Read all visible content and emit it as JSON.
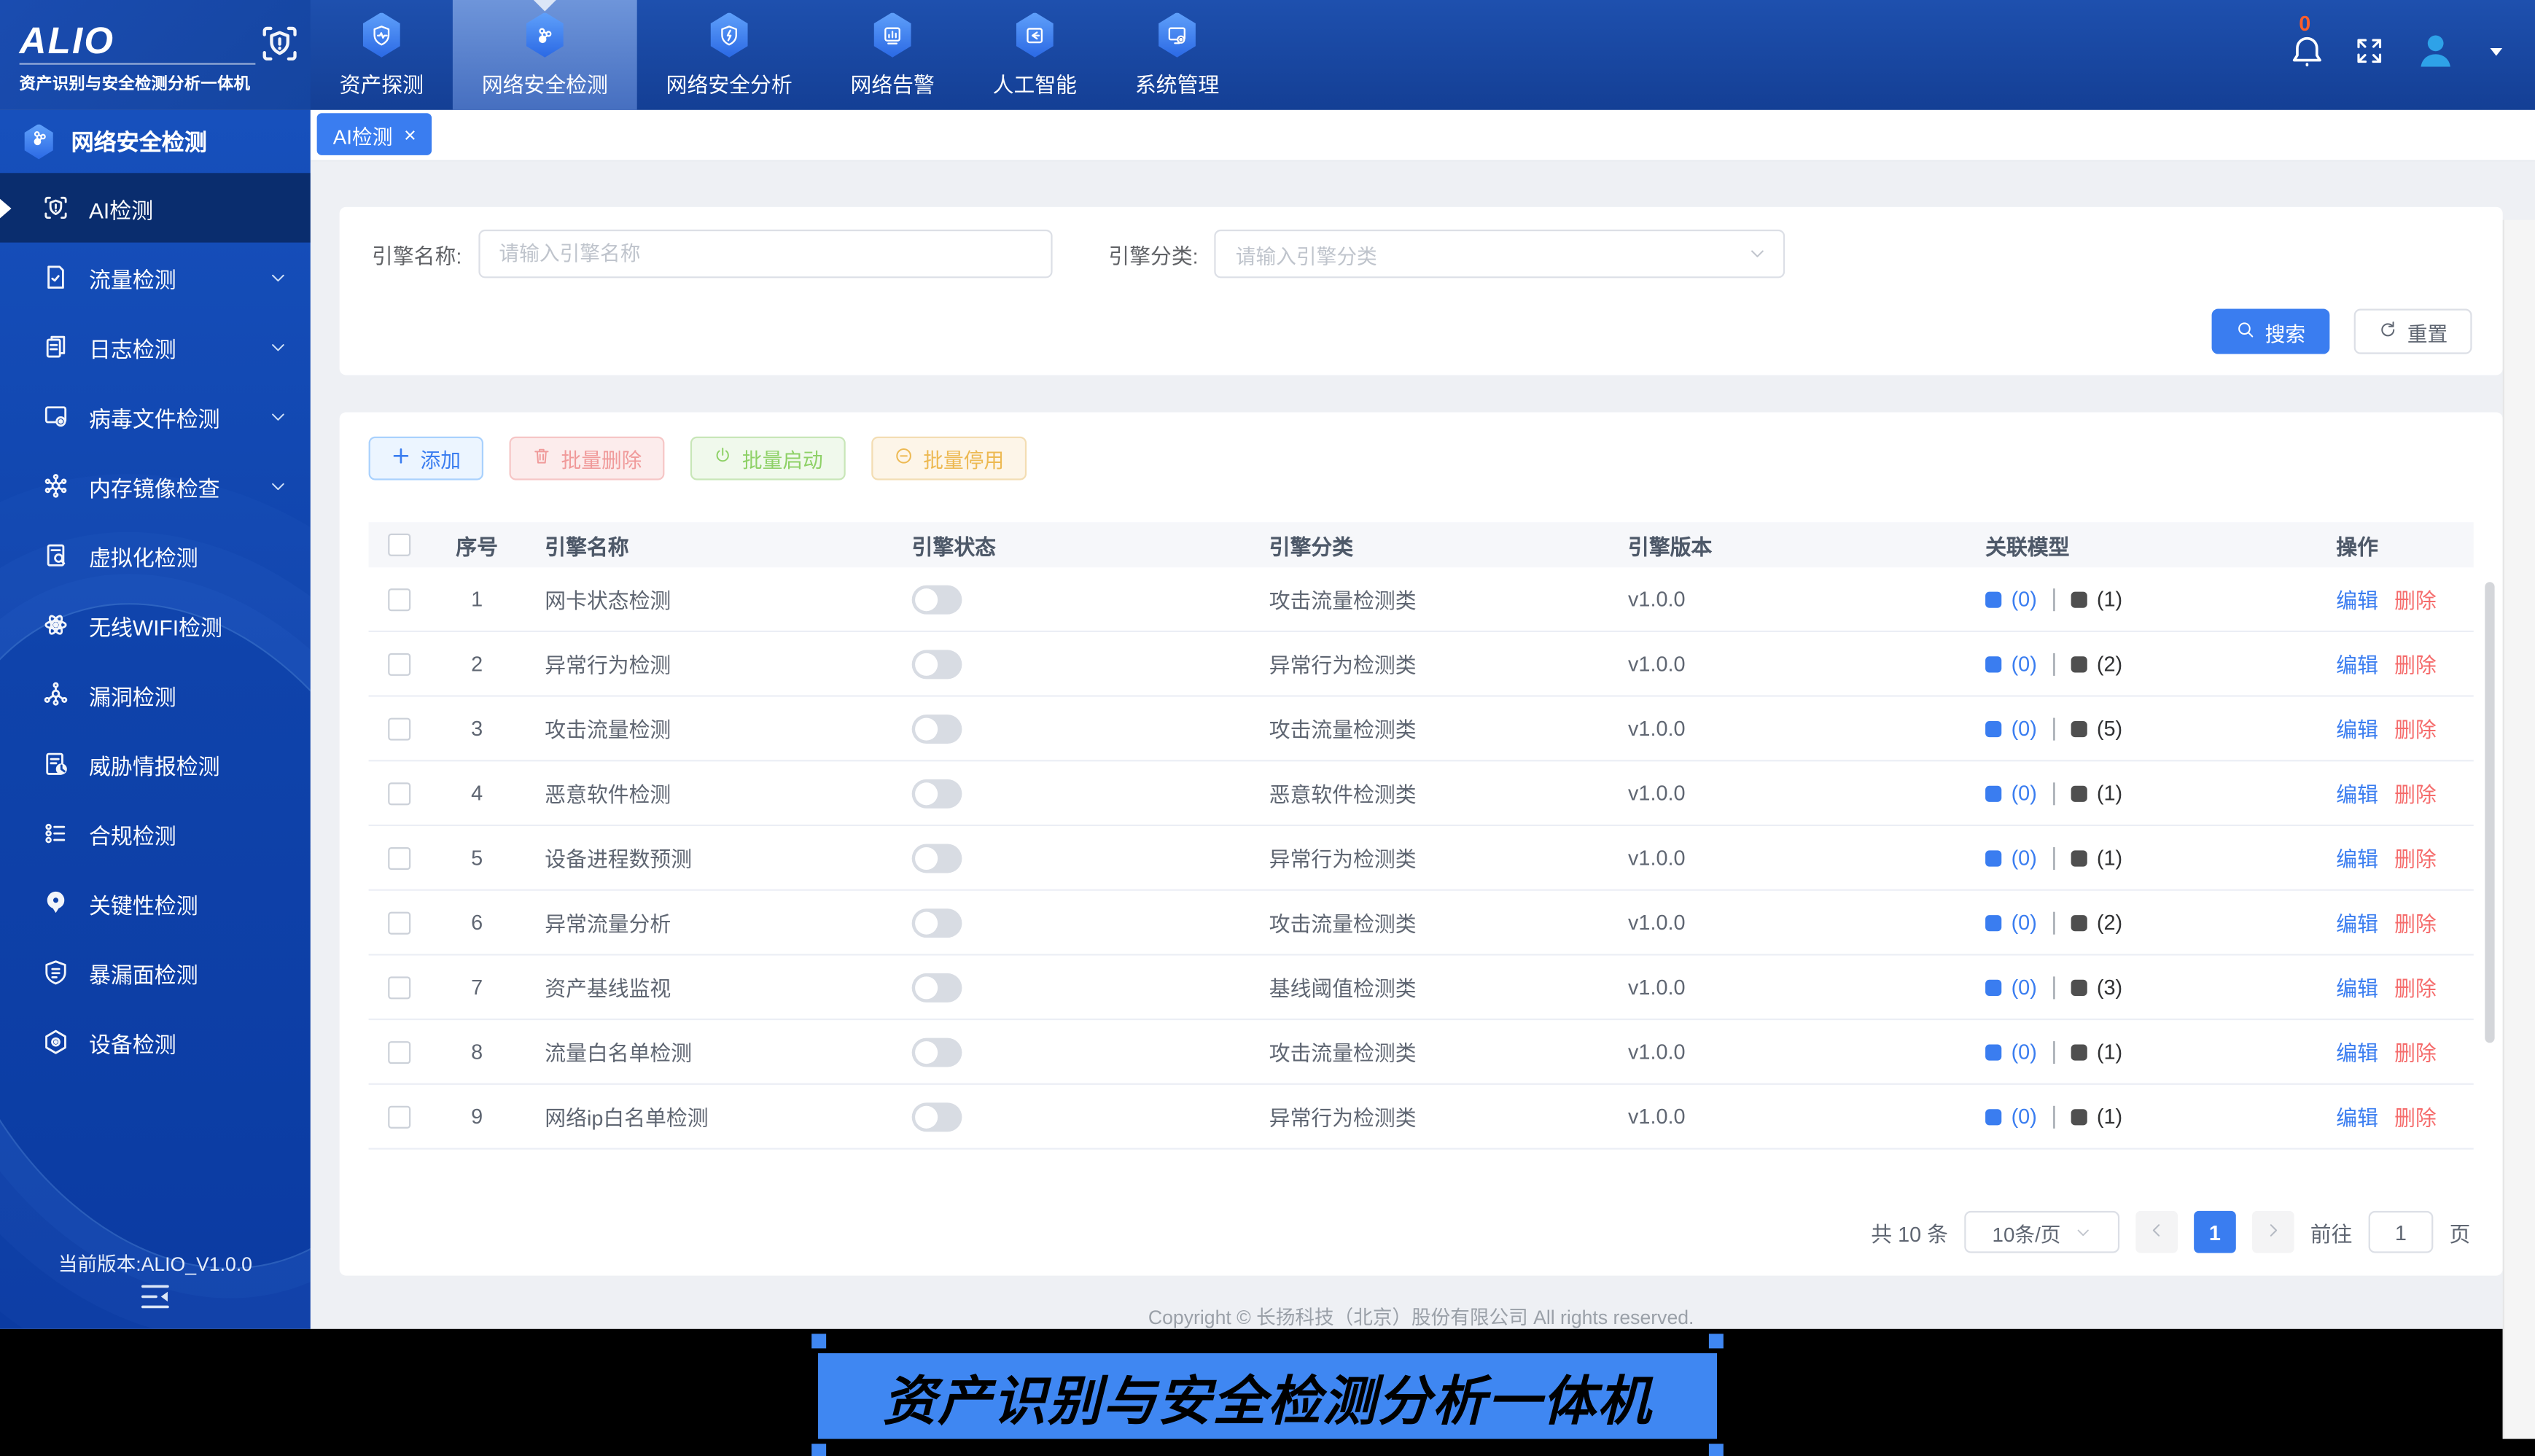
{
  "app": {
    "logo_title": "ALIO",
    "logo_subtitle": "资产识别与安全检测分析一体机",
    "version_label": "当前版本:ALIO_V1.0.0",
    "notification_count": "0"
  },
  "colors": {
    "accent": "#3a7df0",
    "danger": "#f56c6c",
    "success": "#8ed167",
    "warning": "#edb952",
    "nav_bg": "#1e50ae",
    "sidebar_active_bg": "#0a2d6e",
    "caption_bg": "#3f87f2",
    "badge_color": "#ff5e2b"
  },
  "top_nav": {
    "items": [
      {
        "label": "资产探测",
        "icon": "shield-pulse-icon",
        "active": false
      },
      {
        "label": "网络安全检测",
        "icon": "network-nodes-icon",
        "active": true
      },
      {
        "label": "网络安全分析",
        "icon": "shield-lightning-icon",
        "active": false
      },
      {
        "label": "网络告警",
        "icon": "alert-chart-icon",
        "active": false
      },
      {
        "label": "人工智能",
        "icon": "ai-chip-icon",
        "active": false
      },
      {
        "label": "系统管理",
        "icon": "system-gear-icon",
        "active": false
      }
    ]
  },
  "sidebar": {
    "header": {
      "label": "网络安全检测",
      "icon": "network-nodes-icon"
    },
    "items": [
      {
        "label": "AI检测",
        "icon": "scan-shield-icon",
        "active": true,
        "expandable": false
      },
      {
        "label": "流量检测",
        "icon": "document-icon",
        "active": false,
        "expandable": true
      },
      {
        "label": "日志检测",
        "icon": "documents-icon",
        "active": false,
        "expandable": true
      },
      {
        "label": "病毒文件检测",
        "icon": "monitor-gear-icon",
        "active": false,
        "expandable": true
      },
      {
        "label": "内存镜像检查",
        "icon": "network-hub-icon",
        "active": false,
        "expandable": true
      },
      {
        "label": "虚拟化检测",
        "icon": "document-search-icon",
        "active": false,
        "expandable": false
      },
      {
        "label": "无线WIFI检测",
        "icon": "atom-icon",
        "active": false,
        "expandable": false
      },
      {
        "label": "漏洞检测",
        "icon": "molecule-icon",
        "active": false,
        "expandable": false
      },
      {
        "label": "威胁情报检测",
        "icon": "document-chart-icon",
        "active": false,
        "expandable": false
      },
      {
        "label": "合规检测",
        "icon": "checklist-icon",
        "active": false,
        "expandable": false
      },
      {
        "label": "关键性检测",
        "icon": "location-pin-icon",
        "active": false,
        "expandable": false
      },
      {
        "label": "暴漏面检测",
        "icon": "shield-document-icon",
        "active": false,
        "expandable": false
      },
      {
        "label": "设备检测",
        "icon": "hexagon-gear-icon",
        "active": false,
        "expandable": false
      }
    ]
  },
  "tab": {
    "label": "AI检测",
    "close": "×"
  },
  "search_form": {
    "engine_name_label": "引擎名称:",
    "engine_name_placeholder": "请输入引擎名称",
    "engine_category_label": "引擎分类:",
    "engine_category_placeholder": "请输入引擎分类",
    "search_button": "搜索",
    "reset_button": "重置"
  },
  "toolbar": {
    "add": "添加",
    "batch_delete": "批量删除",
    "batch_start": "批量启动",
    "batch_stop": "批量停用"
  },
  "table": {
    "columns": [
      "序号",
      "引擎名称",
      "引擎状态",
      "引擎分类",
      "引擎版本",
      "关联模型",
      "操作"
    ],
    "edit_label": "编辑",
    "delete_label": "删除",
    "rows": [
      {
        "index": "1",
        "name": "网卡状态检测",
        "status_on": false,
        "category": "攻击流量检测类",
        "version": "v1.0.0",
        "model_blue": "(0)",
        "model_dark": "(1)"
      },
      {
        "index": "2",
        "name": "异常行为检测",
        "status_on": false,
        "category": "异常行为检测类",
        "version": "v1.0.0",
        "model_blue": "(0)",
        "model_dark": "(2)"
      },
      {
        "index": "3",
        "name": "攻击流量检测",
        "status_on": false,
        "category": "攻击流量检测类",
        "version": "v1.0.0",
        "model_blue": "(0)",
        "model_dark": "(5)"
      },
      {
        "index": "4",
        "name": "恶意软件检测",
        "status_on": false,
        "category": "恶意软件检测类",
        "version": "v1.0.0",
        "model_blue": "(0)",
        "model_dark": "(1)"
      },
      {
        "index": "5",
        "name": "设备进程数预测",
        "status_on": false,
        "category": "异常行为检测类",
        "version": "v1.0.0",
        "model_blue": "(0)",
        "model_dark": "(1)"
      },
      {
        "index": "6",
        "name": "异常流量分析",
        "status_on": false,
        "category": "攻击流量检测类",
        "version": "v1.0.0",
        "model_blue": "(0)",
        "model_dark": "(2)"
      },
      {
        "index": "7",
        "name": "资产基线监视",
        "status_on": false,
        "category": "基线阈值检测类",
        "version": "v1.0.0",
        "model_blue": "(0)",
        "model_dark": "(3)"
      },
      {
        "index": "8",
        "name": "流量白名单检测",
        "status_on": false,
        "category": "攻击流量检测类",
        "version": "v1.0.0",
        "model_blue": "(0)",
        "model_dark": "(1)"
      },
      {
        "index": "9",
        "name": "网络ip白名单检测",
        "status_on": false,
        "category": "异常行为检测类",
        "version": "v1.0.0",
        "model_blue": "(0)",
        "model_dark": "(1)"
      }
    ]
  },
  "pagination": {
    "total": "共 10 条",
    "page_size": "10条/页",
    "current_page": "1",
    "goto_label": "前往",
    "goto_value": "1",
    "page_label": "页"
  },
  "footer": {
    "copyright": "Copyright © 长扬科技（北京）股份有限公司 All rights reserved."
  },
  "caption": {
    "text": "资产识别与安全检测分析一体机"
  }
}
